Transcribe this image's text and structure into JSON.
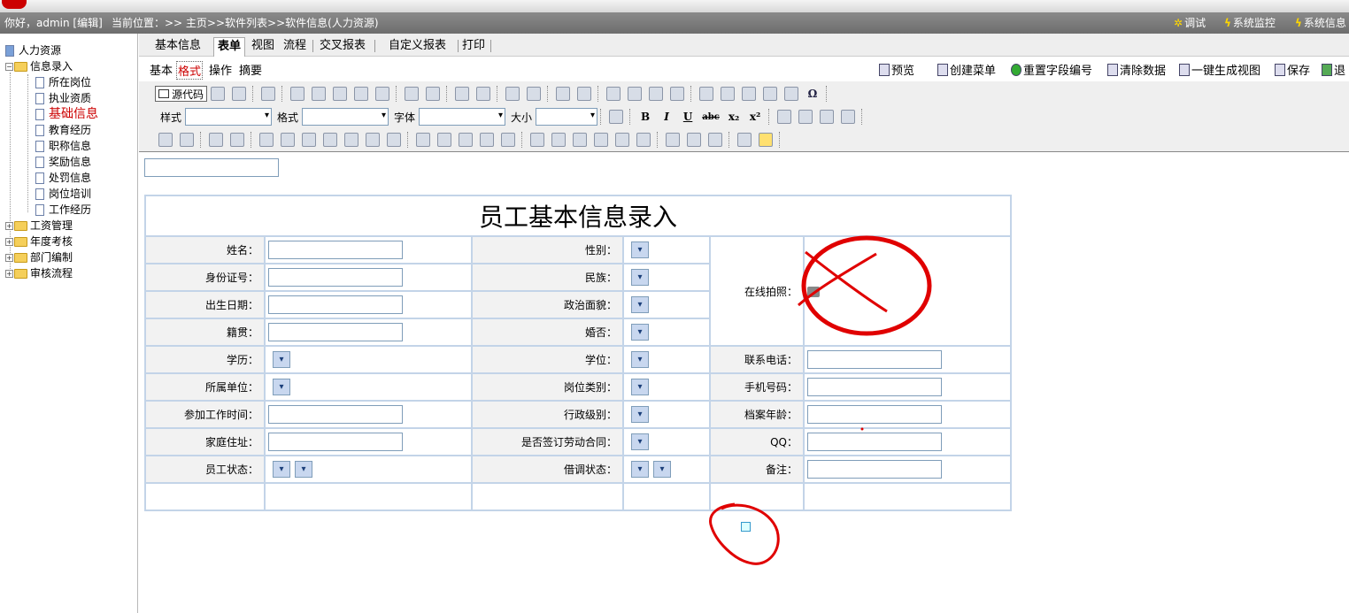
{
  "header": {
    "greeting": "你好，admin [编辑]",
    "breadcrumb": "当前位置：>> 主页>>软件列表>>软件信息(人力资源)",
    "debug": "调试",
    "monitor": "系统监控",
    "sysinfo": "系统信息"
  },
  "sidebar": {
    "root": "人力资源",
    "folders": [
      "信息录入",
      "工资管理",
      "年度考核",
      "部门编制",
      "审核流程"
    ],
    "items": [
      "所在岗位",
      "执业资质",
      "基础信息",
      "教育经历",
      "职称信息",
      "奖励信息",
      "处罚信息",
      "岗位培训",
      "工作经历"
    ],
    "selected_item": "基础信息"
  },
  "tabs": [
    "基本信息",
    "表单",
    "视图",
    "流程",
    "交叉报表",
    "自定义报表",
    "打印"
  ],
  "active_tab": "表单",
  "subtabs": [
    "基本",
    "格式",
    "操作",
    "摘要"
  ],
  "active_subtab": "格式",
  "actions": [
    "预览",
    "创建菜单",
    "重置字段编号",
    "清除数据",
    "一键生成视图",
    "保存",
    "退"
  ],
  "editor": {
    "source_btn": "源代码",
    "style_label": "样式",
    "format_label": "格式",
    "font_label": "字体",
    "size_label": "大小",
    "bold": "B",
    "italic": "I",
    "underline": "U",
    "strike": "abc",
    "sub": "x₂",
    "sup": "x²",
    "omega": "Ω"
  },
  "form": {
    "title": "员工基本信息录入",
    "labels": {
      "name": "姓名：",
      "gender": "性别：",
      "photo": "在线拍照：",
      "idcard": "身份证号：",
      "ethnic": "民族：",
      "birth": "出生日期：",
      "political": "政治面貌：",
      "native": "籍贯：",
      "married": "婚否：",
      "education": "学历：",
      "degree": "学位：",
      "phone": "联系电话：",
      "unit": "所属单位：",
      "post_type": "岗位类别：",
      "mobile": "手机号码：",
      "work_time": "参加工作时间：",
      "admin_level": "行政级别：",
      "archive_age": "档案年龄：",
      "address": "家庭住址：",
      "contract": "是否签订劳动合同：",
      "qq": "QQ：",
      "status": "员工状态：",
      "loan_status": "借调状态：",
      "remark": "备注："
    }
  },
  "colors": {
    "annotation": "#e00000",
    "topbar": "#7a7a7a",
    "cell_border": "#c3d4e8",
    "label_bg": "#f2f2f2"
  }
}
